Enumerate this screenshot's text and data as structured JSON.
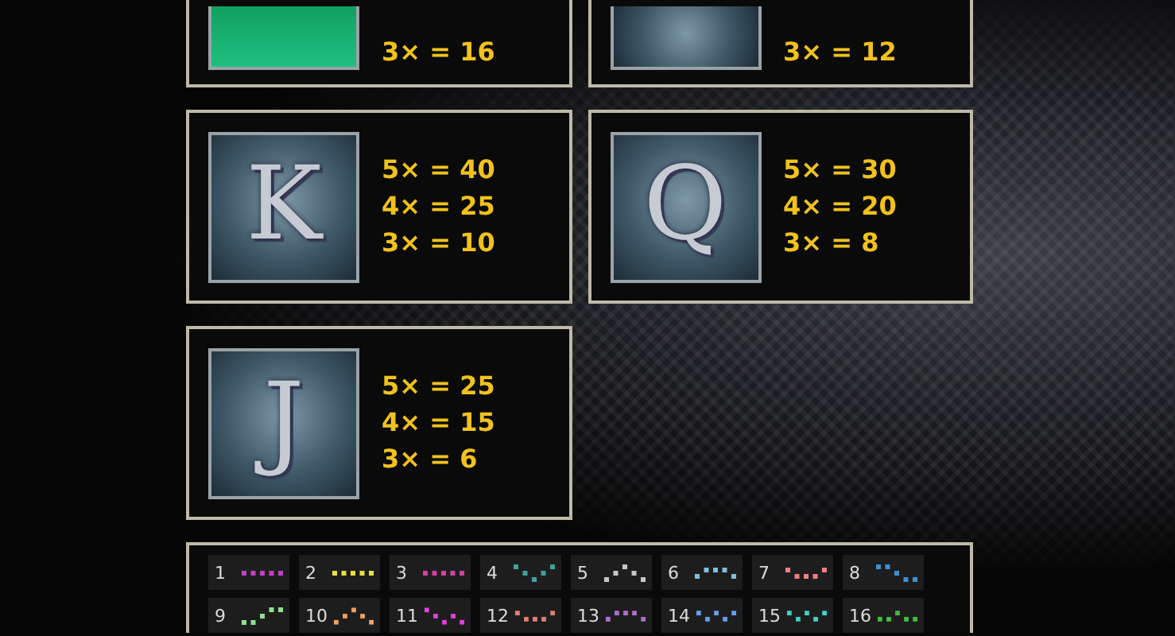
{
  "top_cards": [
    {
      "symbol": {
        "kind": "photo"
      },
      "pays": [
        "3× = 16"
      ]
    },
    {
      "symbol": {
        "kind": "tile"
      },
      "pays": [
        "3× = 12"
      ]
    }
  ],
  "cards": [
    {
      "symbol": {
        "kind": "letter",
        "letter": "K"
      },
      "pays": [
        "5× = 40",
        "4× = 25",
        "3× = 10"
      ]
    },
    {
      "symbol": {
        "kind": "letter",
        "letter": "Q"
      },
      "pays": [
        "5× = 30",
        "4× = 20",
        "3× = 8"
      ]
    },
    {
      "symbol": {
        "kind": "letter",
        "letter": "J"
      },
      "pays": [
        "5× = 25",
        "4× = 15",
        "3× = 6"
      ]
    }
  ],
  "paylines": [
    {
      "number": "1",
      "color": "#c040c0"
    },
    {
      "number": "2",
      "color": "#e8e040"
    },
    {
      "number": "3",
      "color": "#d040a0"
    },
    {
      "number": "4",
      "color": "#40a0a0"
    },
    {
      "number": "5",
      "color": "#c8c8c8"
    },
    {
      "number": "6",
      "color": "#80c0e0"
    },
    {
      "number": "7",
      "color": "#f08080"
    },
    {
      "number": "8",
      "color": "#4090d0"
    },
    {
      "number": "9",
      "color": "#90e090"
    },
    {
      "number": "10",
      "color": "#f0a060"
    },
    {
      "number": "11",
      "color": "#e040e0"
    },
    {
      "number": "12",
      "color": "#e08070"
    },
    {
      "number": "13",
      "color": "#b070d0"
    },
    {
      "number": "14",
      "color": "#60a0f0"
    },
    {
      "number": "15",
      "color": "#40d0d0"
    },
    {
      "number": "16",
      "color": "#40c040"
    }
  ]
}
